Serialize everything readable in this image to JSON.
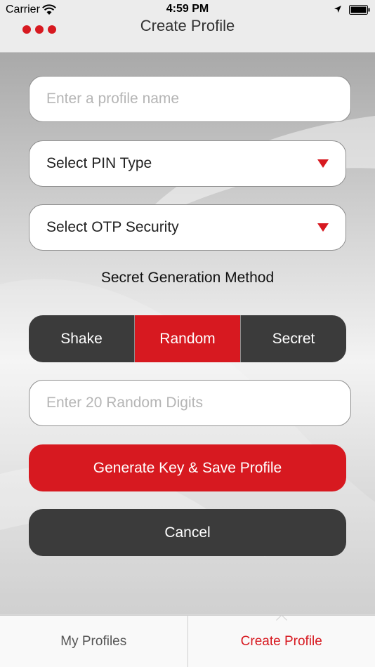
{
  "status_bar": {
    "carrier": "Carrier",
    "time": "4:59 PM",
    "icons": [
      "wifi-icon",
      "location-arrow-icon",
      "battery-icon"
    ]
  },
  "nav": {
    "title": "Create Profile",
    "menu_icon": "menu-dots-icon"
  },
  "form": {
    "profile_name": {
      "value": "",
      "placeholder": "Enter a profile name"
    },
    "pin_type": {
      "label": "Select PIN Type",
      "icon": "triangle-down-icon"
    },
    "otp_security": {
      "label": "Select OTP Security",
      "icon": "triangle-down-icon"
    },
    "secret_method": {
      "label": "Secret Generation Method",
      "options": [
        "Shake",
        "Random",
        "Secret"
      ],
      "selected": "Random"
    },
    "random_digits": {
      "value": "",
      "placeholder": "Enter 20 Random Digits"
    },
    "generate_button": "Generate Key & Save Profile",
    "cancel_button": "Cancel"
  },
  "tabs": [
    {
      "label": "My Profiles",
      "active": false
    },
    {
      "label": "Create Profile",
      "active": true
    }
  ],
  "colors": {
    "accent": "#d71920",
    "dark_button": "#3b3b3b",
    "placeholder": "#b5b5b5"
  }
}
